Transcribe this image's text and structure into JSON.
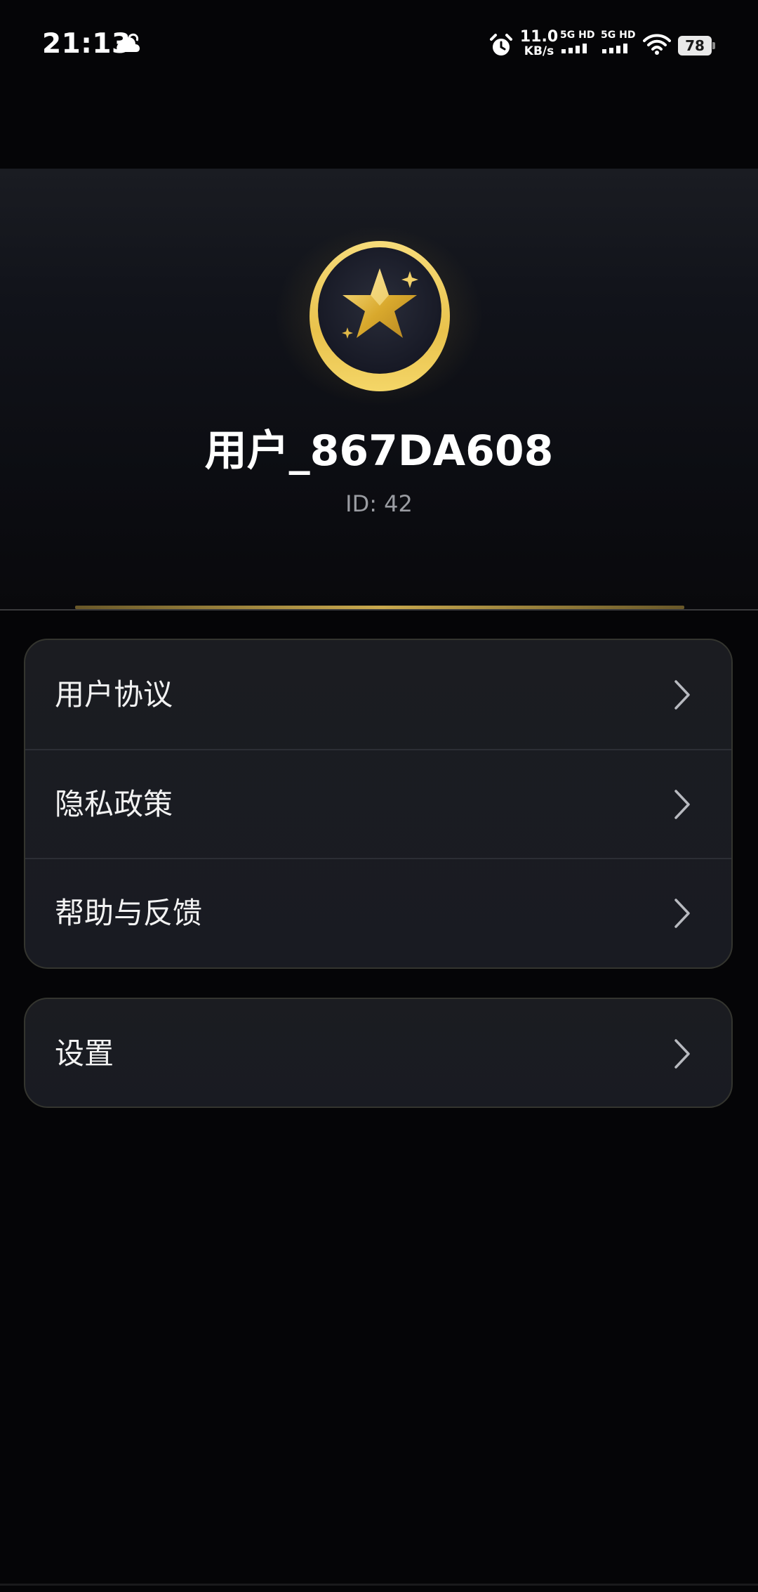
{
  "status_bar": {
    "time": "21:13",
    "net_speed_value": "11.0",
    "net_speed_unit": "KB/s",
    "sim1_label": "5G HD",
    "sim2_label": "5G HD",
    "battery_level": "78",
    "icons": [
      "cloud-icon",
      "alarm-icon",
      "signal-icon",
      "wifi-icon",
      "battery-icon"
    ]
  },
  "profile": {
    "username": "用户_867DA608",
    "user_id": "ID: 42",
    "avatar_icon": "star-avatar-icon",
    "accent_color": "#e6c04a"
  },
  "menu": {
    "group1": [
      {
        "label": "用户协议",
        "icon": "chevron-right-icon"
      },
      {
        "label": "隐私政策",
        "icon": "chevron-right-icon"
      },
      {
        "label": "帮助与反馈",
        "icon": "chevron-right-icon"
      }
    ],
    "group2": [
      {
        "label": "设置",
        "icon": "chevron-right-icon"
      }
    ]
  },
  "colors": {
    "background": "#050507",
    "card_background": "#1b1c21",
    "card_border": "#34352f",
    "gold": "#e6c04a",
    "secondary_text": "#9a9ca2"
  }
}
